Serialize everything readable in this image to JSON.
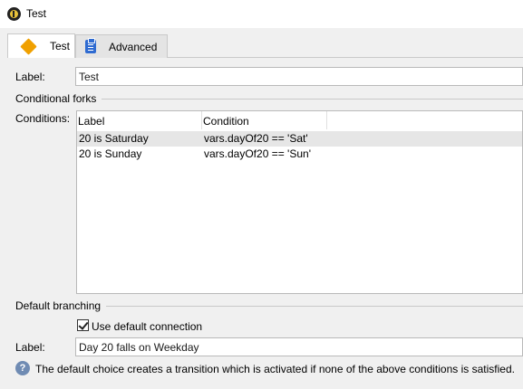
{
  "window": {
    "title": "Test"
  },
  "tabs": [
    {
      "label": "Test",
      "icon": "diamond-icon",
      "active": true
    },
    {
      "label": "Advanced",
      "icon": "clipboard-icon",
      "active": false
    }
  ],
  "form": {
    "label_caption": "Label:",
    "label_value": "Test",
    "conditional_forks_title": "Conditional forks",
    "conditions_caption": "Conditions:",
    "columns": [
      "Label",
      "Condition"
    ],
    "rows": [
      {
        "label": "20 is Saturday",
        "condition": "vars.dayOf20 == 'Sat'"
      },
      {
        "label": "20 is Sunday",
        "condition": "vars.dayOf20 == 'Sun'"
      }
    ],
    "default_branching_title": "Default branching",
    "use_default_connection_label": "Use default connection",
    "use_default_connection_checked": true,
    "default_label_caption": "Label:",
    "default_label_value": "Day 20 falls on Weekday",
    "info_text": "The default choice creates a transition which is activated if none of the above conditions is satisfied."
  },
  "colors": {
    "diamond": "#f0a000",
    "clipboard": "#2f6bd1",
    "info": "#6f8bb3",
    "selected_row": "#e6e6e6"
  }
}
